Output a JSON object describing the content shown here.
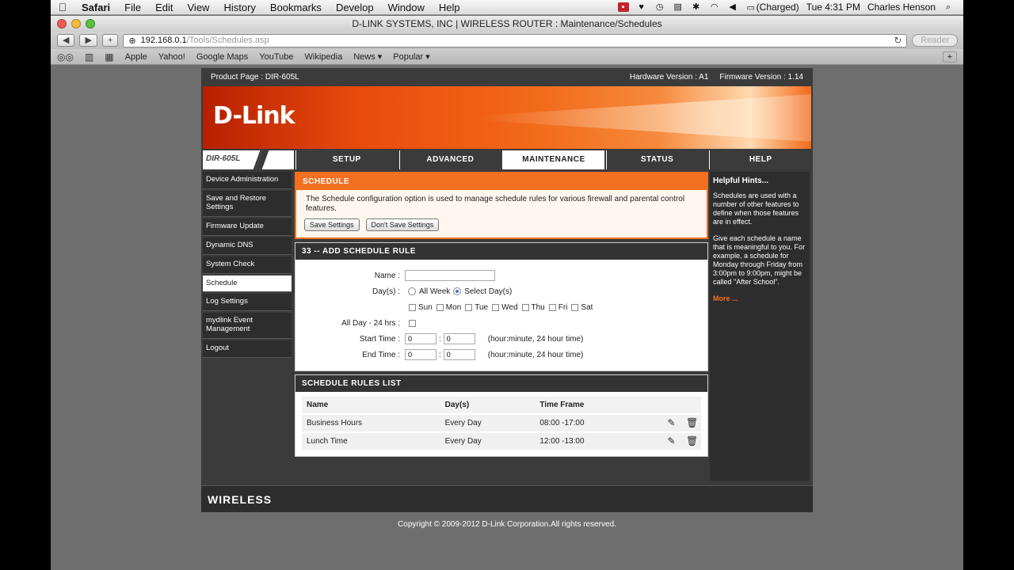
{
  "menubar": {
    "apple": "",
    "items": [
      "Safari",
      "File",
      "Edit",
      "View",
      "History",
      "Bookmarks",
      "Develop",
      "Window",
      "Help"
    ],
    "battery": "(Charged)",
    "clock": "Tue 4:31 PM",
    "user": "Charles Henson"
  },
  "window": {
    "title": "D-LINK SYSTEMS, INC | WIRELESS ROUTER : Maintenance/Schedules"
  },
  "toolbar": {
    "back": "◀",
    "forward": "▶",
    "add": "+",
    "url_host": "192.168.0.1",
    "url_path": "/Tools/Schedules.asp",
    "reader": "Reader"
  },
  "bookmarks": [
    "Apple",
    "Yahoo!",
    "Google Maps",
    "YouTube",
    "Wikipedia",
    "News ▾",
    "Popular ▾"
  ],
  "router": {
    "product_page": "Product Page : DIR-605L",
    "hardware_version": "Hardware Version : A1",
    "firmware_version": "Firmware Version : 1.14",
    "logo": "D-Link",
    "model": "DIR-605L",
    "tabs": [
      "SETUP",
      "ADVANCED",
      "MAINTENANCE",
      "STATUS",
      "HELP"
    ],
    "sidebar": [
      "Device Administration",
      "Save and Restore Settings",
      "Firmware Update",
      "Dynamic DNS",
      "System Check",
      "Schedule",
      "Log Settings",
      "mydlink Event Management",
      "Logout"
    ],
    "schedule": {
      "title": "SCHEDULE",
      "description": "The Schedule configuration option is used to manage schedule rules for various firewall and parental control features.",
      "save_button": "Save Settings",
      "dont_save_button": "Don't Save Settings"
    },
    "add_rule": {
      "title": "33 -- ADD SCHEDULE RULE",
      "name_label": "Name :",
      "name_value": "",
      "days_label": "Day(s) :",
      "all_week": "All Week",
      "select_days": "Select Day(s)",
      "day_names": [
        "Sun",
        "Mon",
        "Tue",
        "Wed",
        "Thu",
        "Fri",
        "Sat"
      ],
      "all_day_label": "All Day - 24 hrs :",
      "start_label": "Start Time :",
      "end_label": "End Time :",
      "start_hour": "0",
      "start_min": "0",
      "end_hour": "0",
      "end_min": "0",
      "time_hint": "(hour:minute, 24 hour time)"
    },
    "rules_list": {
      "title": "SCHEDULE RULES LIST",
      "columns": [
        "Name",
        "Day(s)",
        "Time Frame"
      ],
      "rows": [
        {
          "name": "Business Hours",
          "days": "Every Day",
          "time": "08:00 -17:00"
        },
        {
          "name": "Lunch Time",
          "days": "Every Day",
          "time": "12:00 -13:00"
        }
      ]
    },
    "hints": {
      "title": "Helpful Hints...",
      "p1": "Schedules are used with a number of other features to define when those features are in effect.",
      "p2": "Give each schedule a name that is meaningful to you. For example, a schedule for Monday through Friday from 3:00pm to 9:00pm, might be called \"After School\".",
      "more": "More ..."
    },
    "footer": "WIRELESS",
    "copyright": "Copyright © 2009-2012 D-Link Corporation.All rights reserved."
  },
  "colors": {
    "accent": "#f37020",
    "dark": "#3b3b3b"
  }
}
